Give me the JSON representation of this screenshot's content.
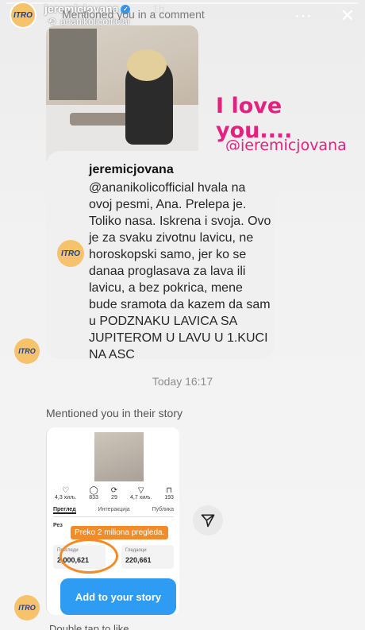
{
  "header": {
    "username": "jeremicjovana",
    "time": "1h",
    "subtitle": "ananikolicofficial",
    "mention_text": "Mentioned you in a comment"
  },
  "overlay": {
    "love_text": "I love you....",
    "tag_text": "@jeremicjovana"
  },
  "comment": {
    "username": "jeremicjovana",
    "text": "@ananikolicofficial hvala na ovoj pesmi, Ana. Prelepa je. Toliko nasa. Iskrena i svoja. Ovo je za svaku zivotnu lavicu, ne horoskopski samo, jer ko se danaa proglasava za lava ili lavicu, a bez pokrica, mene bude sramota da kazem da sam u PODZNAKU LAVICA SA JUPITEROM U LAVU U 1.KUCI NA ASC"
  },
  "timestamp": "Today 16:17",
  "story_mention": {
    "label": "Mentioned you in their story",
    "stats": [
      {
        "icon": "♡",
        "value": "4,3 хиљ."
      },
      {
        "icon": "◯",
        "value": "833"
      },
      {
        "icon": "⟳",
        "value": "29"
      },
      {
        "icon": "▽",
        "value": "4,7 хиљ."
      },
      {
        "icon": "⊓",
        "value": "193"
      }
    ],
    "tabs": [
      "Преглед",
      "Интеракција",
      "Публика"
    ],
    "results_label": "Рез",
    "banner": "Preko 2 miliona pregleda.",
    "views_label": "Прегледи",
    "views_value": "2,000,621",
    "viewers_label": "Гледаоци",
    "viewers_value": "220,661",
    "add_button": "Add to your story"
  },
  "footer": {
    "double_tap": "Double tap to like"
  },
  "avatar_text": "ITRO"
}
